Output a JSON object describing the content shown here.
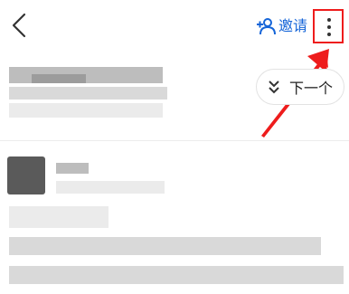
{
  "header": {
    "back_icon": "chevron-left-icon",
    "invite_icon": "add-person-icon",
    "invite_label": "邀请",
    "more_icon": "more-vertical-icon"
  },
  "toolbar": {
    "next_icon": "double-chevron-down-icon",
    "next_label": "下一个"
  },
  "annotation": {
    "highlight_color": "#ee1c1c",
    "accent_color": "#1565d8"
  }
}
